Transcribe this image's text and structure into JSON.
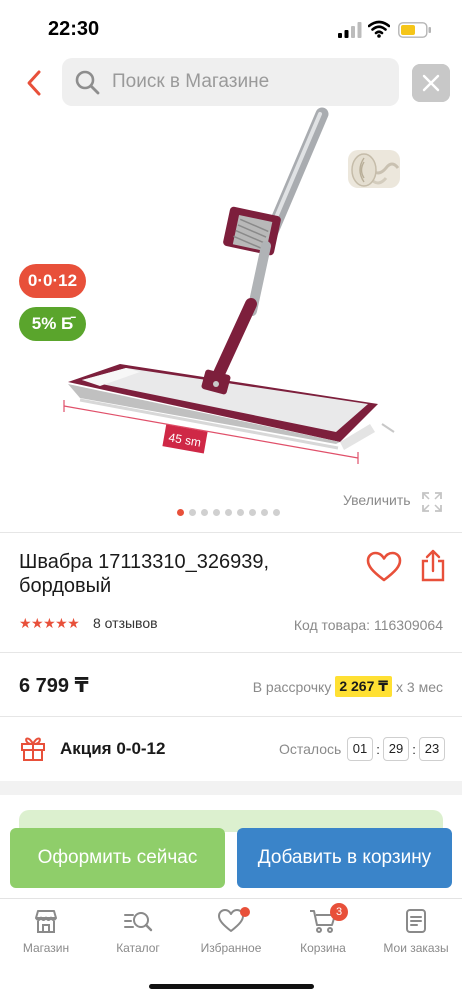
{
  "status": {
    "time": "22:30"
  },
  "search": {
    "placeholder": "Поиск в Магазине"
  },
  "badges": {
    "promo": "0·0·12",
    "cashback": "5%"
  },
  "gallery": {
    "zoom_label": "Увеличить",
    "image_count": 9,
    "active_index": 0,
    "size_label": "45 sm"
  },
  "product": {
    "title": "Швабра 17113310_326939, бордовый",
    "rating": 5,
    "stars": "★★★★★",
    "reviews": "8 отзывов",
    "sku": "Код товара: 116309064",
    "price": "6 799 ₸",
    "installment_label": "В рассрочку",
    "installment_amount": "2 267 ₸",
    "installment_term": "х 3 мес"
  },
  "promo": {
    "name": "Акция 0-0-12",
    "remaining_label": "Осталось",
    "timer": {
      "hours": "01",
      "minutes": "29",
      "seconds": "23"
    }
  },
  "actions": {
    "buy_now": "Оформить сейчас",
    "add_to_cart": "Добавить в корзину"
  },
  "nav": [
    {
      "label": "Магазин",
      "icon": "shop-icon"
    },
    {
      "label": "Каталог",
      "icon": "catalog-search-icon"
    },
    {
      "label": "Избранное",
      "icon": "heart-icon"
    },
    {
      "label": "Корзина",
      "icon": "cart-icon",
      "badge": "3"
    },
    {
      "label": "Мои заказы",
      "icon": "orders-icon"
    }
  ],
  "colors": {
    "accent": "#e8503a",
    "green": "#5aa52c",
    "buy": "#8fce6a",
    "cart": "#3a84c9",
    "mop": "#7d1f3c"
  }
}
